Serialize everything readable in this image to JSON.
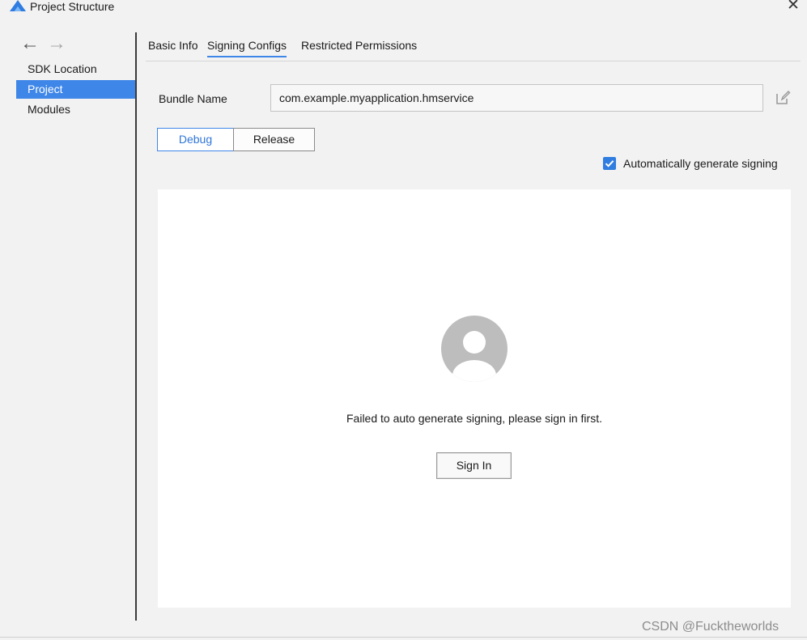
{
  "window": {
    "title": "Project Structure",
    "close_label": "✕"
  },
  "nav": {
    "back_icon": "arrow-left-icon",
    "forward_icon": "arrow-right-icon",
    "back_glyph": "←",
    "forward_glyph": "→"
  },
  "sidebar": {
    "items": [
      {
        "label": "SDK Location",
        "selected": false
      },
      {
        "label": "Project",
        "selected": true
      },
      {
        "label": "Modules",
        "selected": false
      }
    ]
  },
  "tabs": [
    {
      "label": "Basic Info",
      "active": false
    },
    {
      "label": "Signing Configs",
      "active": true
    },
    {
      "label": "Restricted Permissions",
      "active": false
    }
  ],
  "bundle": {
    "label": "Bundle Name",
    "value": "com.example.myapplication.hmservice"
  },
  "build_type": {
    "options": [
      "Debug",
      "Release"
    ],
    "selected": "Debug"
  },
  "auto_sign": {
    "label": "Automatically generate signing",
    "checked": true
  },
  "signin_panel": {
    "message": "Failed to auto generate signing, please sign in first.",
    "button": "Sign In"
  },
  "watermark": "CSDN @Fucktheworlds",
  "colors": {
    "accent": "#3e86e8",
    "checkbox": "#2f7de1",
    "background": "#f2f2f2",
    "panel": "#ffffff"
  }
}
